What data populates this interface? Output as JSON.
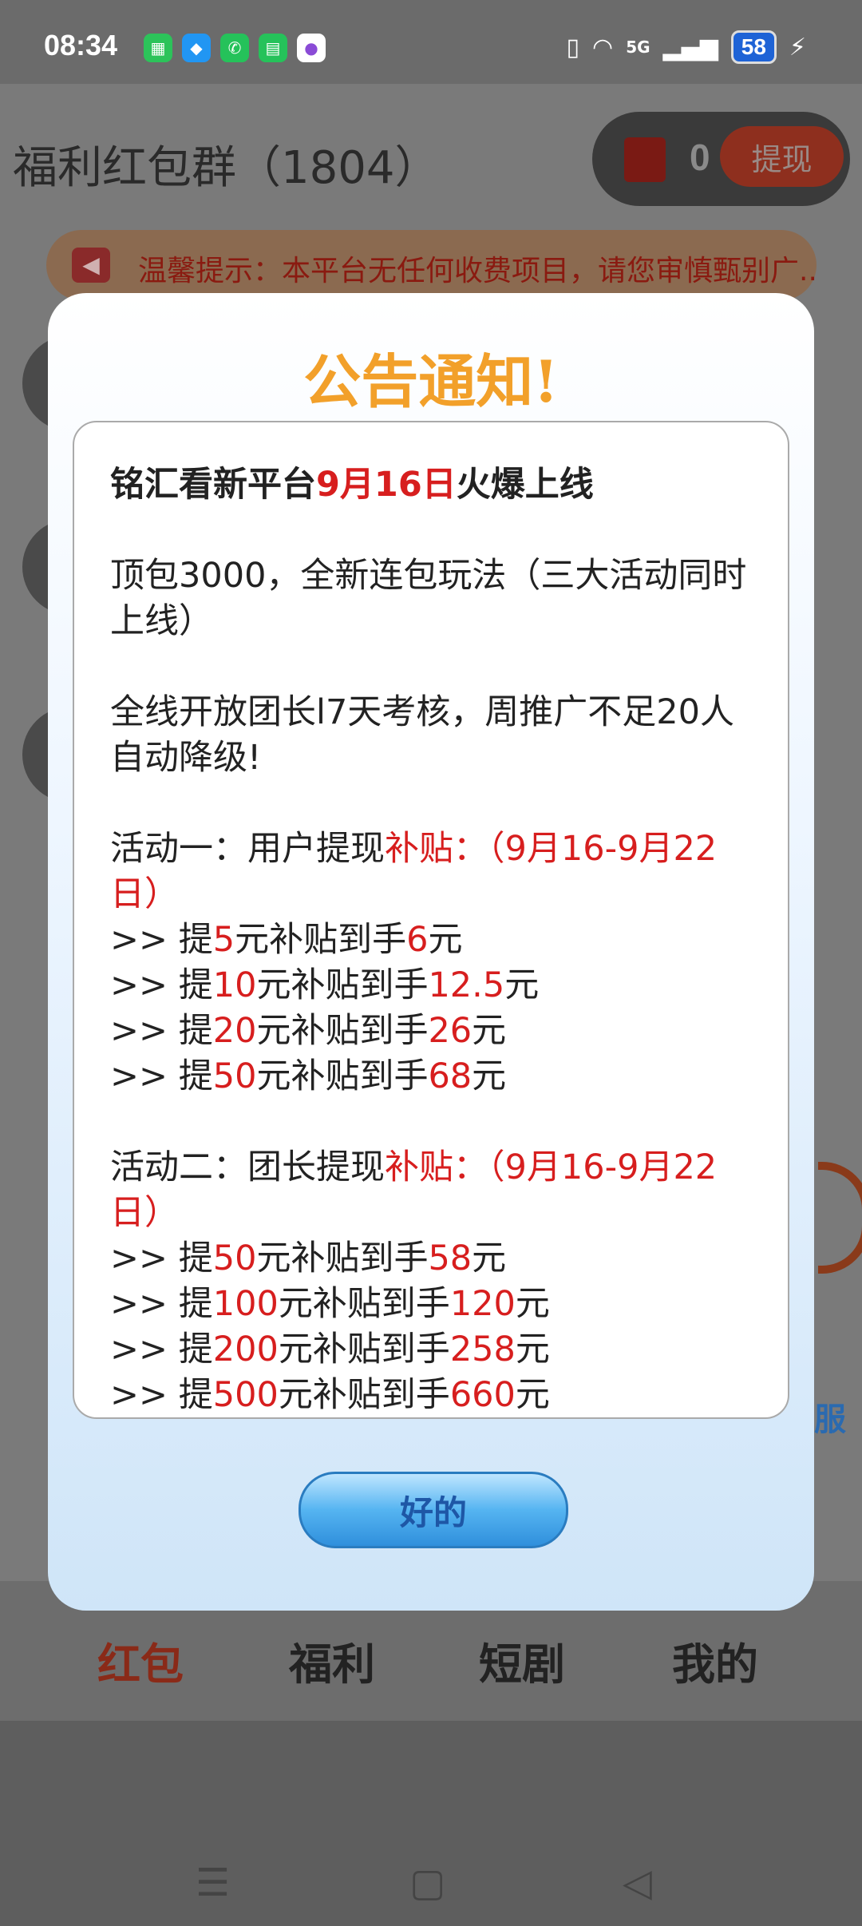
{
  "status_bar": {
    "time": "08:34",
    "network": "5G",
    "battery": "58"
  },
  "header": {
    "group_title": "福利红包群（1804）",
    "balance": "0",
    "withdraw_label": "提现"
  },
  "notice_bar": {
    "text": "温馨提示：本平台无任何收费项目，请您审慎甄别广.."
  },
  "side_fragment": {
    "service_label": "服"
  },
  "bottom_nav": {
    "tabs": [
      "红包",
      "福利",
      "短剧",
      "我的"
    ],
    "active": "红包"
  },
  "modal": {
    "title": "公告通知!",
    "headline": {
      "before": "铭汇看新平台",
      "date": "9月16日",
      "after": "火爆上线"
    },
    "para1": "顶包3000，全新连包玩法（三大活动同时上线）",
    "para2": "全线开放团长l7天考核，周推广不足20人自动降级!",
    "activity1": {
      "label": "活动一：用户提现",
      "highlight": "补贴：（9月16-9月22日）",
      "rows": [
        {
          "prefix": ">> 提",
          "amount": "5",
          "mid": "元补贴到手",
          "get": "6",
          "suffix": "元"
        },
        {
          "prefix": ">> 提",
          "amount": "10",
          "mid": "元补贴到手",
          "get": "12.5",
          "suffix": "元"
        },
        {
          "prefix": ">> 提",
          "amount": "20",
          "mid": "元补贴到手",
          "get": "26",
          "suffix": "元"
        },
        {
          "prefix": ">> 提",
          "amount": "50",
          "mid": "元补贴到手",
          "get": "68",
          "suffix": "元"
        }
      ]
    },
    "activity2": {
      "label": "活动二：团长提现",
      "highlight": "补贴：（9月16-9月22日）",
      "rows": [
        {
          "prefix": ">> 提",
          "amount": "50",
          "mid": "元补贴到手",
          "get": "58",
          "suffix": "元"
        },
        {
          "prefix": ">> 提",
          "amount": "100",
          "mid": "元补贴到手",
          "get": "120",
          "suffix": "元"
        },
        {
          "prefix": ">> 提",
          "amount": "200",
          "mid": "元补贴到手",
          "get": "258",
          "suffix": "元"
        },
        {
          "prefix": ">> 提",
          "amount": "500",
          "mid": "元补贴到手",
          "get": "660",
          "suffix": "元"
        }
      ]
    },
    "ok_label": "好的"
  },
  "colors": {
    "title_orange": "#f2a02a",
    "highlight_red": "#d71e1e",
    "button_blue": "#3a9be6"
  }
}
